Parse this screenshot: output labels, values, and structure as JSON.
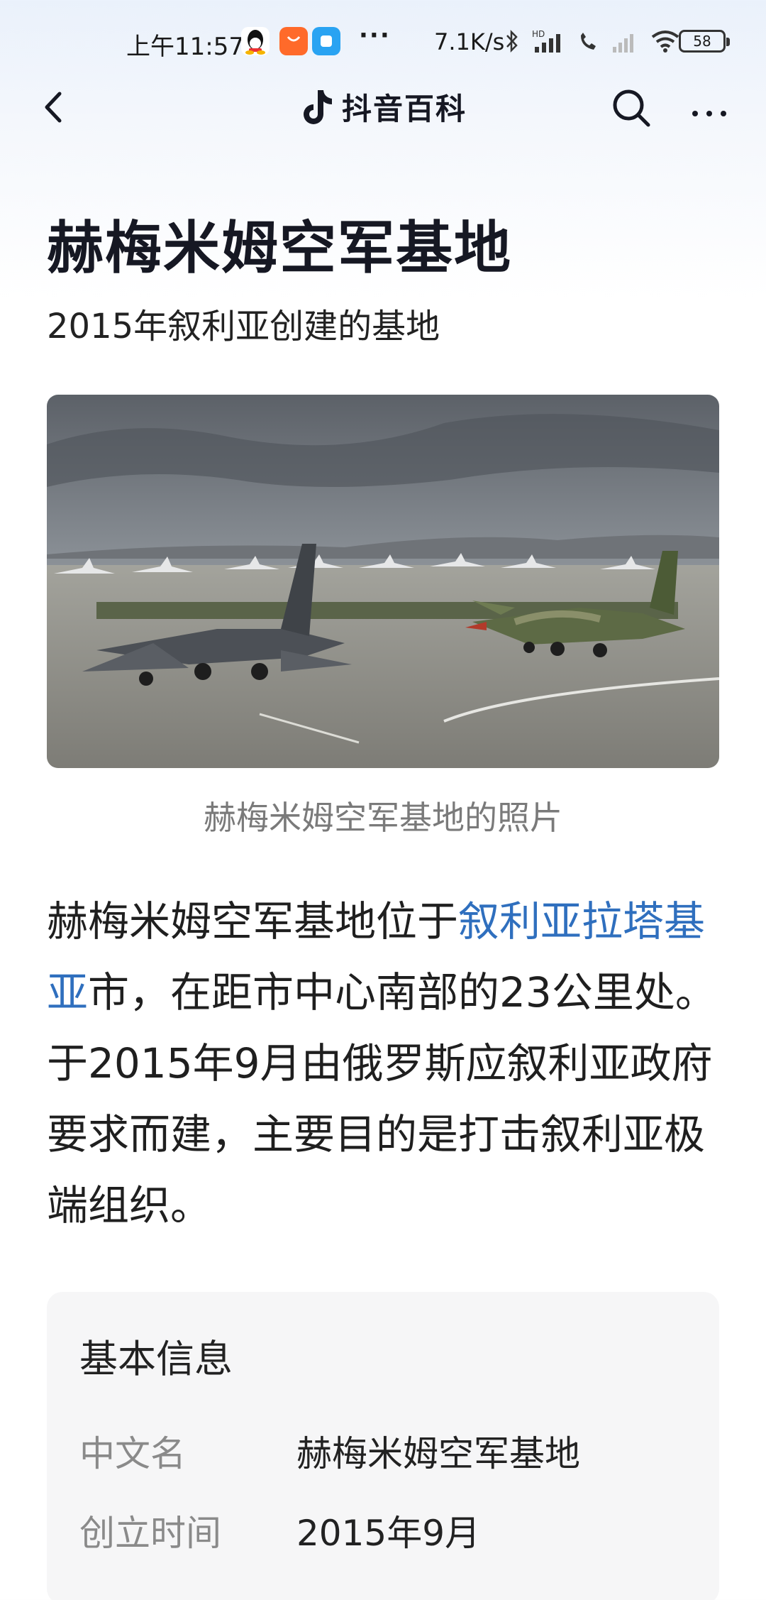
{
  "status_bar": {
    "time": "上午11:57",
    "more": "···",
    "net_speed": "7.1K/s",
    "battery": "58",
    "icons": [
      "qq-icon",
      "taobao-icon",
      "app-icon",
      "bluetooth-icon",
      "hd-signal-icon",
      "call-icon",
      "signal-icon",
      "wifi-icon"
    ]
  },
  "nav": {
    "brand": "抖音百科",
    "icons": [
      "back-icon",
      "tiktok-logo-icon",
      "search-icon",
      "more-icon"
    ]
  },
  "article": {
    "title": "赫梅米姆空军基地",
    "subtitle": "2015年叙利亚创建的基地",
    "photo_caption": "赫梅米姆空军基地的照片",
    "intro_before_link": "赫梅米姆空军基地位于",
    "intro_link": "叙利亚拉塔基亚",
    "intro_after_link": "市，在距市中心南部的23公里处。于2015年9月由俄罗斯应叙利亚政府要求而建，主要目的是打击叙利亚极端组织。"
  },
  "info_card": {
    "title": "基本信息",
    "rows": [
      {
        "key": "中文名",
        "value": "赫梅米姆空军基地"
      },
      {
        "key": "创立时间",
        "value": "2015年9月"
      }
    ]
  },
  "colors": {
    "link": "#2f6fbe",
    "text": "#161823",
    "caption": "#7a7a7a"
  }
}
